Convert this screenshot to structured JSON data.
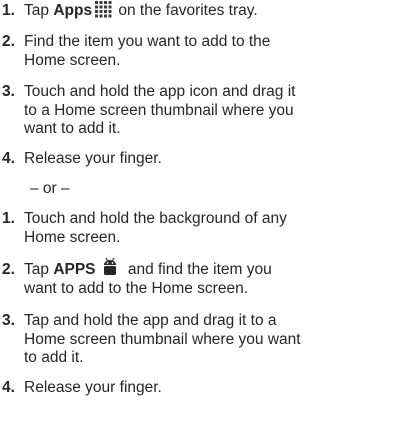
{
  "steps_a": [
    {
      "num": "1.",
      "lines": {
        "pre": "Tap ",
        "strong": "Apps",
        "post": " on the favorites tray."
      }
    },
    {
      "num": "2.",
      "line1": "Find the item you want to add to the",
      "line2": "Home screen."
    },
    {
      "num": "3.",
      "line1": "Touch and hold the app icon and drag it",
      "line2": "to a Home screen thumbnail where you",
      "line3": "want to add it."
    },
    {
      "num": "4.",
      "line1": "Release your finger."
    }
  ],
  "separator": "– or –",
  "steps_b": [
    {
      "num": "1.",
      "line1": "Touch and hold the background of any",
      "line2": "Home screen."
    },
    {
      "num": "2.",
      "pre": "Tap ",
      "strong": "APPS",
      "post": " and find the item you",
      "line2": "want to add to the Home screen."
    },
    {
      "num": "3.",
      "line1": "Tap and hold the app and drag it to a",
      "line2": "Home screen thumbnail where you want",
      "line3": "to add it."
    },
    {
      "num": "4.",
      "line1": "Release your finger."
    }
  ],
  "icons": {
    "apps": "apps-grid-icon",
    "android": "android-icon"
  },
  "colors": {
    "text": "#262626"
  }
}
